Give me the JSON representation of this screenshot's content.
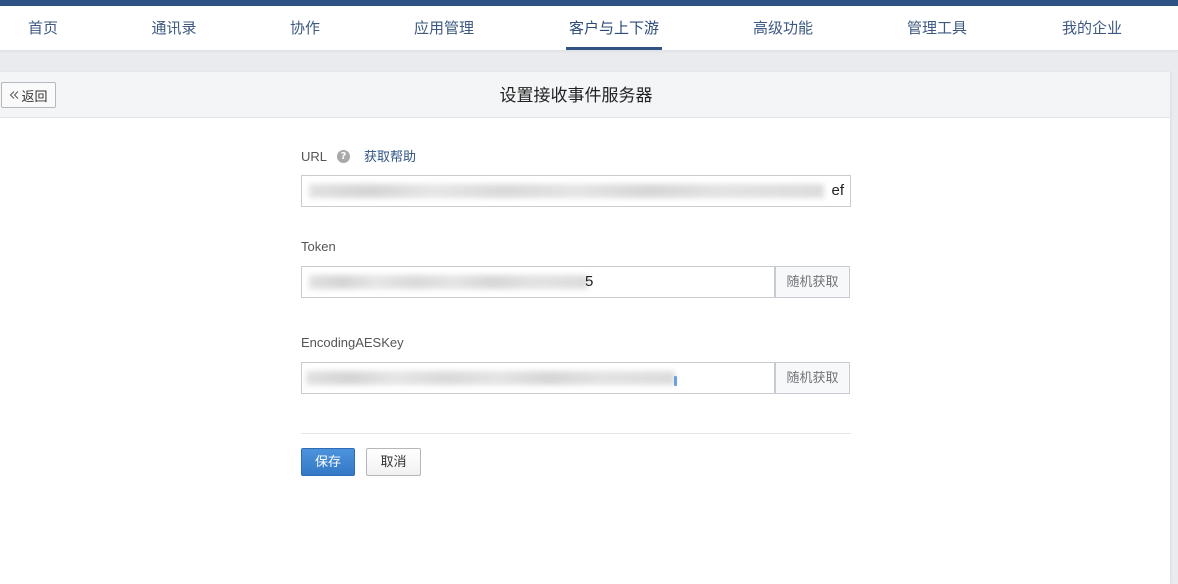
{
  "colors": {
    "top_bar": "#2f5383",
    "nav_text": "#3d5980",
    "link": "#2f5383",
    "primary_button": "#3479c6"
  },
  "nav": {
    "active_index": 4,
    "items": [
      {
        "label": "首页"
      },
      {
        "label": "通讯录"
      },
      {
        "label": "协作"
      },
      {
        "label": "应用管理"
      },
      {
        "label": "客户与上下游"
      },
      {
        "label": "高级功能"
      },
      {
        "label": "管理工具"
      },
      {
        "label": "我的企业"
      }
    ]
  },
  "header": {
    "back_button": {
      "icon": "double-chevron-left-icon",
      "label": "返回"
    },
    "title": "设置接收事件服务器"
  },
  "form": {
    "url": {
      "label": "URL",
      "help_icon": "question-circle-icon",
      "help_link": "获取帮助",
      "value_visible_tail": "ef"
    },
    "token": {
      "label": "Token",
      "value_visible_tail": "5",
      "button": "随机获取"
    },
    "aes_key": {
      "label": "EncodingAESKey",
      "button": "随机获取"
    },
    "save_button": "保存",
    "cancel_button": "取消"
  }
}
